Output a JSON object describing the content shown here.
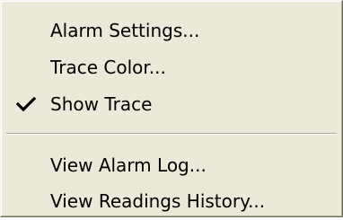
{
  "menu": {
    "items": [
      {
        "label": "Alarm Settings...",
        "checked": false
      },
      {
        "label": "Trace Color...",
        "checked": false
      },
      {
        "label": "Show Trace",
        "checked": true
      },
      {
        "label": "View Alarm Log...",
        "checked": false
      },
      {
        "label": "View Readings History...",
        "checked": false
      }
    ],
    "check_icon": "checkmark-icon",
    "colors": {
      "background": "#ece9d8",
      "text": "#000000",
      "separator_dark": "#aca899",
      "separator_light": "#ffffff"
    }
  }
}
